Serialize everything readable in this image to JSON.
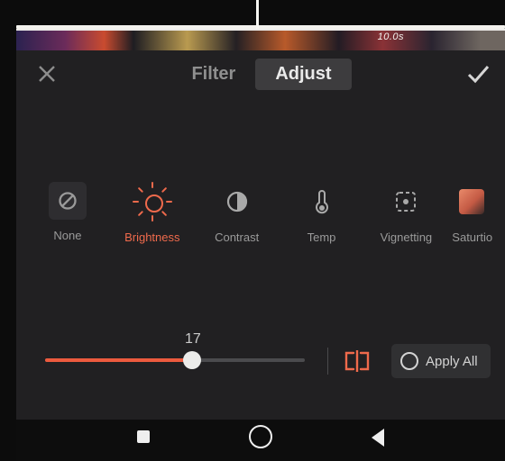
{
  "timeline": {
    "time_label": "10.0s"
  },
  "tabs": {
    "filter": "Filter",
    "adjust": "Adjust",
    "active": "adjust"
  },
  "adjustments": {
    "items": [
      {
        "key": "none",
        "label": "None"
      },
      {
        "key": "brightness",
        "label": "Brightness"
      },
      {
        "key": "contrast",
        "label": "Contrast"
      },
      {
        "key": "temp",
        "label": "Temp"
      },
      {
        "key": "vignetting",
        "label": "Vignetting"
      },
      {
        "key": "saturation",
        "label": "Saturtio"
      }
    ],
    "selected": "brightness"
  },
  "slider": {
    "value": 17,
    "min": 0,
    "max": 100
  },
  "apply_all_label": "Apply All"
}
